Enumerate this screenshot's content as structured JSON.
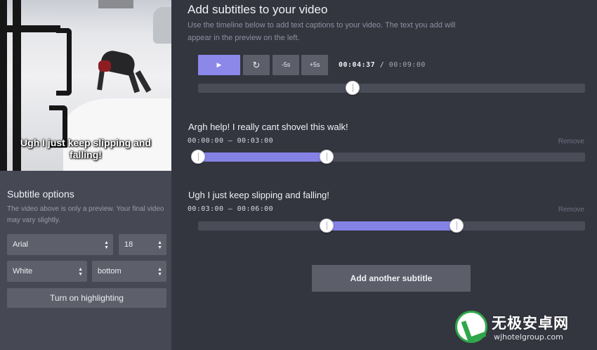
{
  "video": {
    "caption_preview": "Ugh I just keep slipping and falling!"
  },
  "options": {
    "title": "Subtitle options",
    "note": "The video above is only a preview. Your final video may vary slightly.",
    "font": "Arial",
    "size": "18",
    "color": "White",
    "position": "bottom",
    "highlight_button": "Turn on highlighting"
  },
  "header": {
    "title": "Add subtitles to your video",
    "description": "Use the timeline below to add text captions to your video. The text you add will appear in the preview on the left."
  },
  "player": {
    "play_icon": "play-icon",
    "play_glyph": "▶",
    "replay_icon": "replay-icon",
    "replay_glyph": "↻",
    "back_label": "-5s",
    "forward_label": "+5s",
    "current_time": "00:04:37",
    "separator": "/",
    "total_time": "00:09:00",
    "progress": 0.4
  },
  "subtitles": [
    {
      "text": "Argh help! I really cant shovel this walk!",
      "range": "00:00:00 – 00:03:00",
      "remove_label": "Remove",
      "start_fraction": 0.0,
      "end_fraction": 0.333
    },
    {
      "text": "Ugh I just keep slipping and falling!",
      "range": "00:03:00 – 00:06:00",
      "remove_label": "Remove",
      "start_fraction": 0.333,
      "end_fraction": 0.667
    }
  ],
  "add_subtitle_label": "Add another subtitle",
  "watermark": {
    "logo_icon": "wjhotelgroup-logo-icon",
    "name": "无极安卓网",
    "url": "wjhotelgroup.com"
  },
  "colors": {
    "accent": "#8b88ea",
    "panel": "#464854",
    "background": "#33353f"
  }
}
